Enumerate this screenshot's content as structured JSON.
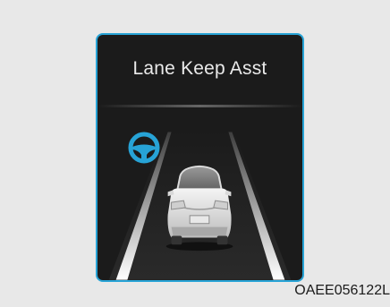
{
  "panel": {
    "title": "Lane Keep Asst",
    "accent_color": "#27a3d6",
    "indicator_icon": "steering-wheel-icon",
    "vehicle_icon": "car-rear-view-icon"
  },
  "caption": {
    "code": "OAEE056122L"
  }
}
